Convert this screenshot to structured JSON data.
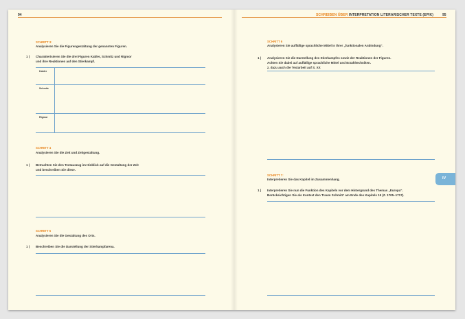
{
  "left_page": {
    "page_number": "94",
    "sections": [
      {
        "step": "SCHRITT 3:",
        "instruction": "Analysieren Sie die Figurengestaltung der genannten Figuren.",
        "task_number": "1",
        "task_lines": [
          "Charakterisieren Sie die drei Figuren Kabler, Schmitz und Rigmor",
          "und ihre Reaktionen auf den Stierkampf."
        ],
        "table_rows": [
          "Kabler",
          "Schmitz",
          "Rigmor"
        ]
      },
      {
        "step": "SCHRITT 4",
        "instruction": "Analysieren Sie die Zeit und Zeitgestaltung.",
        "task_number": "1",
        "task_lines": [
          "Betrachten Sie den Textauszug im Hinblick auf die Gestaltung der Zeit",
          "und beschreiben Sie diese."
        ]
      },
      {
        "step": "SCHRITT 5",
        "instruction": "Analysieren Sie die Gestaltung des Orts.",
        "task_number": "1",
        "task_lines": [
          "Beschreiben Sie die Darstellung der Stierkampfarena."
        ]
      }
    ]
  },
  "right_page": {
    "page_number": "95",
    "running_head": {
      "orange": "SCHREIBEN ÜBER",
      "dark": "INTERPRETATION LITERARISCHER TEXTE (EPIK)"
    },
    "sections": [
      {
        "step": "SCHRITT 6",
        "instruction": "Analysieren Sie auffällige sprachliche Mittel in ihrer „funktionalen Anbindung“.",
        "task_number": "1",
        "task_lines": [
          "Analysieren Sie die Darstellung des Stierkampfes sowie der Reaktionen der Figuren.",
          "Achten Sie dabei auf auffällige sprachliche Mittel und Erzähltechniken.",
          "z. dazu auch die Textarbeit auf S. XX"
        ]
      },
      {
        "step": "SCHRITT 7:",
        "instruction": "Interpretieren Sie das Kapitel im Zusammenhang.",
        "task_number": "1",
        "task_lines": [
          "Interpretieren Sie nun die Funktion des Kapitels vor dem Hintergrund des Themas „Europa“.",
          "Berücksichtigen Sie als Kontext den Traum Schmitz' am Ende des Kapitels 15 (Z. 1705–1717)."
        ]
      }
    ],
    "chapter_tab": "IV"
  },
  "colors": {
    "accent_orange": "#e8841e",
    "rule_blue": "#6fa3cc",
    "tab_blue": "#7ab4d8",
    "paper": "#fdfae8"
  }
}
